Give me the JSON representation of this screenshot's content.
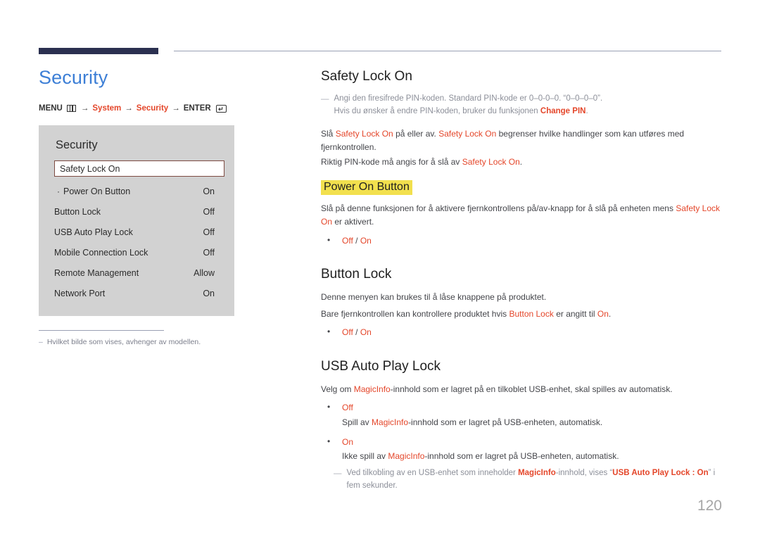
{
  "header": {
    "accent_color": "#2b3050",
    "rule_color": "#9aa0b4"
  },
  "left": {
    "page_title": "Security",
    "menu_path": {
      "menu_label": "MENU",
      "menu_icon": "menu-grid-icon",
      "arrow": "→",
      "item1": "System",
      "item2": "Security",
      "enter_label": "ENTER",
      "enter_icon": "enter-return-icon"
    },
    "osd": {
      "title": "Security",
      "selected_item": "Safety Lock On",
      "rows": [
        {
          "dot": "·",
          "label": "Power On Button",
          "value": "On",
          "sub": true
        },
        {
          "dot": "",
          "label": "Button Lock",
          "value": "Off",
          "sub": false
        },
        {
          "dot": "",
          "label": "USB Auto Play Lock",
          "value": "Off",
          "sub": false
        },
        {
          "dot": "",
          "label": "Mobile Connection Lock",
          "value": "Off",
          "sub": false
        },
        {
          "dot": "",
          "label": "Remote Management",
          "value": "Allow",
          "sub": false
        },
        {
          "dot": "",
          "label": "Network Port",
          "value": "On",
          "sub": false
        }
      ]
    },
    "footnote": {
      "dash": "–",
      "text": "Hvilket bilde som vises, avhenger av modellen."
    }
  },
  "right": {
    "section1": {
      "title": "Safety Lock On",
      "note": {
        "dash": "—",
        "line1_a": "Angi den firesifrede PIN-koden. Standard PIN-kode er 0–0-0–0. “0–0–0–0”.",
        "line2_a": "Hvis du ønsker å endre PIN-koden, bruker du funksjonen ",
        "line2_link": "Change PIN",
        "line2_b": "."
      },
      "p1_a": "Slå ",
      "p1_link1": "Safety Lock On",
      "p1_b": " på eller av. ",
      "p1_link2": "Safety Lock On",
      "p1_c": " begrenser hvilke handlinger som kan utføres med fjernkontrollen.",
      "p2_a": "Riktig PIN-kode må angis for å slå av ",
      "p2_link": "Safety Lock On",
      "p2_b": "."
    },
    "subsection1": {
      "highlight_title": "Power On Button",
      "p1_a": "Slå på denne funksjonen for å aktivere fjernkontrollens på/av-knapp for å slå på enheten mens ",
      "p1_link": "Safety Lock On",
      "p1_b": " er aktivert.",
      "options": {
        "off": "Off",
        "sep": " / ",
        "on": "On"
      }
    },
    "section2": {
      "title": "Button Lock",
      "p1": "Denne menyen kan brukes til å låse knappene på produktet.",
      "p2_a": "Bare fjernkontrollen kan kontrollere produktet hvis ",
      "p2_link1": "Button Lock",
      "p2_b": " er angitt til ",
      "p2_link2": "On",
      "p2_c": ".",
      "options": {
        "off": "Off",
        "sep": " / ",
        "on": "On"
      }
    },
    "section3": {
      "title": "USB Auto Play Lock",
      "p1_a": "Velg om ",
      "p1_link": "MagicInfo",
      "p1_b": "-innhold som er lagret på en tilkoblet USB-enhet, skal spilles av automatisk.",
      "opt_off": {
        "label": "Off",
        "desc_a": "Spill av ",
        "desc_link": "MagicInfo",
        "desc_b": "-innhold som er lagret på USB-enheten, automatisk."
      },
      "opt_on": {
        "label": "On",
        "desc_a": "Ikke spill av ",
        "desc_link": "MagicInfo",
        "desc_b": "-innhold som er lagret på USB-enheten, automatisk."
      },
      "note": {
        "dash": "—",
        "a": "Ved tilkobling av en USB-enhet som inneholder ",
        "link1": "MagicInfo",
        "b": "-innhold, vises “",
        "link2": "USB Auto Play Lock : On",
        "c": "” i fem sekunder."
      }
    }
  },
  "page_number": "120",
  "colors": {
    "accent_red": "#e4462a",
    "title_blue": "#3d7fd6",
    "highlight_yellow": "#f2e04e",
    "osd_bg": "#d2d2d2",
    "note_gray": "#8c8f99"
  }
}
